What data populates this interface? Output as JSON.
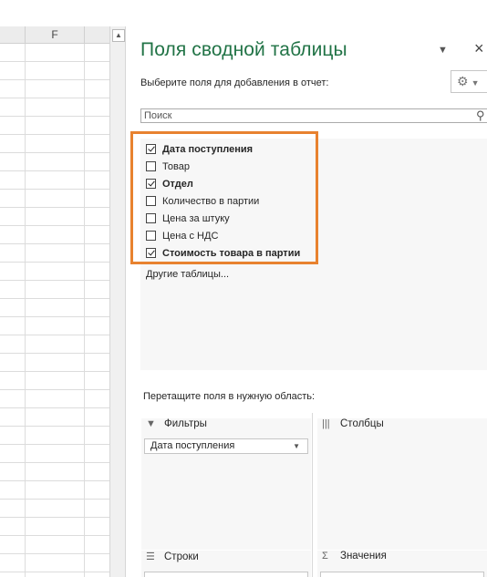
{
  "sheet": {
    "columns": [
      "",
      "F",
      ""
    ]
  },
  "pane": {
    "title": "Поля сводной таблицы",
    "dropdown_icon": "caret-down",
    "close_icon": "×",
    "subtitle": "Выберите поля для добавления в отчет:",
    "settings_icon": "gear-icon",
    "search": {
      "placeholder": "Поиск"
    },
    "fields": [
      {
        "label": "Дата поступления",
        "checked": true
      },
      {
        "label": "Товар",
        "checked": false
      },
      {
        "label": "Отдел",
        "checked": true
      },
      {
        "label": "Количество в партии",
        "checked": false
      },
      {
        "label": "Цена за штуку",
        "checked": false
      },
      {
        "label": "Цена с НДС",
        "checked": false
      },
      {
        "label": "Стоимость товара в партии",
        "checked": true
      }
    ],
    "other_tables": "Другие таблицы...",
    "drag_hint": "Перетащите поля в нужную область:",
    "areas": {
      "filters": {
        "label": "Фильтры",
        "items": [
          "Дата поступления"
        ]
      },
      "columns": {
        "label": "Столбцы",
        "items": []
      },
      "rows": {
        "label": "Строки"
      },
      "values": {
        "label": "Значения"
      }
    }
  },
  "colors": {
    "accent_green": "#217346",
    "highlight_orange": "#e8822f"
  }
}
